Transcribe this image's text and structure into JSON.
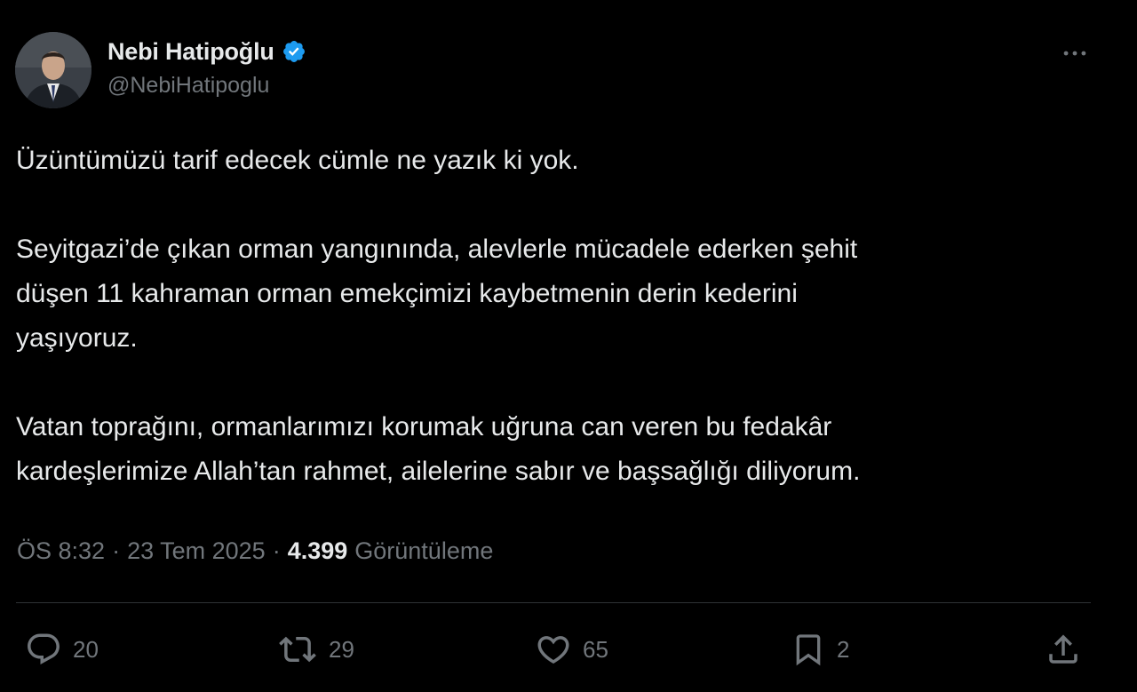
{
  "author": {
    "name": "Nebi Hatipoğlu",
    "handle": "@NebiHatipoglu",
    "verified_color": "#1d9bf0"
  },
  "tweet": {
    "paragraphs": [
      "Üzüntümüzü tarif edecek cümle ne yazık ki yok.",
      "Seyitgazi’de çıkan orman yangınında, alevlerle mücadele ederken şehit\ndüşen 11 kahraman  orman emekçimizi kaybetmenin derin kederini\nyaşıyoruz.",
      "Vatan toprağını, ormanlarımızı korumak uğruna can veren bu fedakâr\nkardeşlerimize Allah’tan rahmet, ailelerine sabır ve başsağlığı diliyorum."
    ]
  },
  "meta": {
    "time": "ÖS 8:32",
    "separator": "·",
    "date": "23 Tem 2025",
    "views_count": "4.399",
    "views_label": "Görüntüleme"
  },
  "actions": {
    "replies": "20",
    "reposts": "29",
    "likes": "65",
    "bookmarks": "2"
  },
  "icons": {
    "more": "more-horizontal-icon",
    "reply": "reply-icon",
    "repost": "repost-icon",
    "like": "heart-icon",
    "bookmark": "bookmark-icon",
    "share": "share-icon"
  },
  "colors": {
    "background": "#000000",
    "text": "#e7e9ea",
    "muted": "#71767b",
    "divider": "#2f3336"
  }
}
